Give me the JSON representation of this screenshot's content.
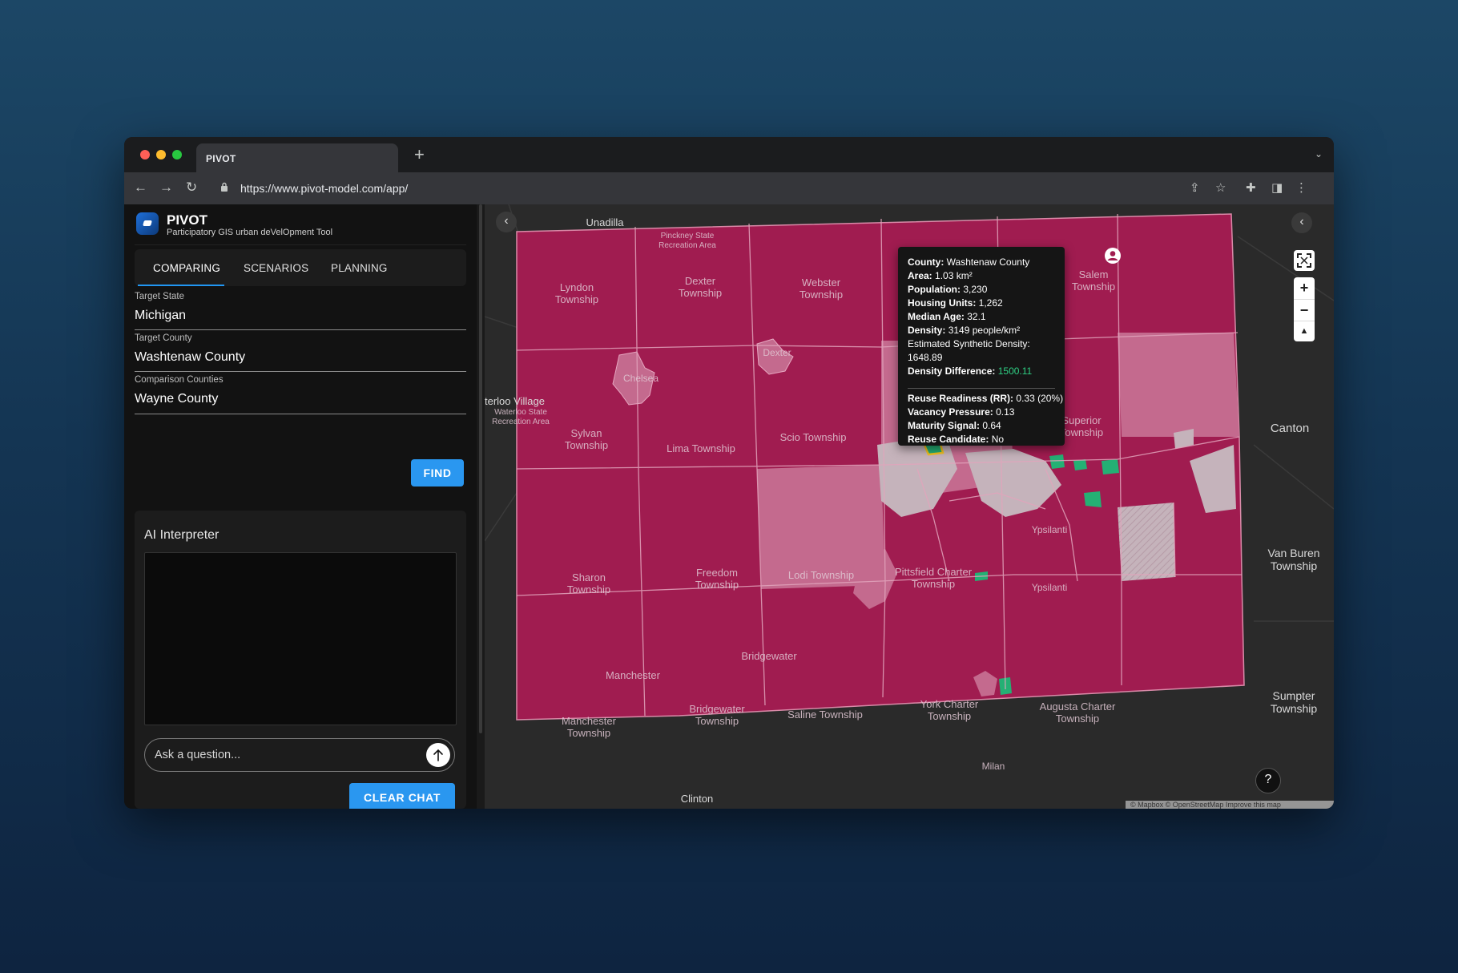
{
  "browser": {
    "tab_title": "PIVOT",
    "new_tab": "+",
    "url": "https://www.pivot-model.com/app/"
  },
  "app": {
    "title": "PIVOT",
    "subtitle": "Participatory GIS urban deVelOpment Tool"
  },
  "tabs": [
    {
      "label": "COMPARING",
      "active": true
    },
    {
      "label": "SCENARIOS",
      "active": false
    },
    {
      "label": "PLANNING",
      "active": false
    }
  ],
  "form": {
    "target_state": {
      "label": "Target State",
      "value": "Michigan"
    },
    "target_county": {
      "label": "Target County",
      "value": "Washtenaw County"
    },
    "comparison_counties": {
      "label": "Comparison Counties",
      "value": "Wayne County"
    },
    "find_label": "FIND"
  },
  "ai": {
    "title": "AI Interpreter",
    "placeholder": "Ask a question...",
    "clear_label": "CLEAR CHAT"
  },
  "map": {
    "colors": {
      "high": "#a01c50",
      "mid": "#c46a8e",
      "low": "#c5b3bb",
      "positive": "#24b074",
      "highlight": "#f0c020"
    },
    "inside_labels": {
      "lyndon": "Lyndon\nTownship",
      "dexter_tp": "Dexter\nTownship",
      "webster": "Webster\nTownship",
      "salem": "Salem\nTownship",
      "pinckney": "Pinckney State\nRecreation Area",
      "chelsea": "Chelsea",
      "dexter": "Dexter",
      "scio": "Scio Township",
      "sylvan": "Sylvan\nTownship",
      "lima": "Lima Township",
      "superior": "Superior\nTownship",
      "sharon": "Sharon\nTownship",
      "freedom": "Freedom\nTownship",
      "lodi": "Lodi Township",
      "pittsfield": "Pittsfield Charter\nTownship",
      "ypsilanti_city": "Ypsilanti",
      "ypsilanti": "Ypsilanti",
      "manchester": "Manchester",
      "manchester_tp": "Manchester\nTownship",
      "bridgewater": "Bridgewater",
      "bridgewater_tp": "Bridgewater\nTownship",
      "saline": "Saline Township",
      "york": "York Charter\nTownship",
      "augusta": "Augusta Charter\nTownship",
      "milan": "Milan",
      "waterloo_area": "Waterloo State\nRecreation Area"
    },
    "outside_labels": {
      "unadilla": "Unadilla",
      "waterloo": "terloo Village",
      "canton": "Canton",
      "van_buren": "Van Buren\nTownship",
      "sumpter": "Sumpter\nTownship",
      "clinton": "Clinton"
    },
    "tooltip": {
      "county": {
        "label": "County:",
        "value": "Washtenaw County"
      },
      "area": {
        "label": "Area:",
        "value": "1.03 km²"
      },
      "population": {
        "label": "Population:",
        "value": "3,230"
      },
      "housing": {
        "label": "Housing Units:",
        "value": "1,262"
      },
      "median_age": {
        "label": "Median Age:",
        "value": "32.1"
      },
      "density": {
        "label": "Density:",
        "value": "3149 people/km²"
      },
      "synthetic": {
        "label": "Estimated Synthetic Density:",
        "value": "1648.89"
      },
      "difference": {
        "label": "Density Difference:",
        "value": "1500.11"
      },
      "reuse": {
        "label": "Reuse Readiness (RR):",
        "value": "0.33 (20%)"
      },
      "vacancy": {
        "label": "Vacancy Pressure:",
        "value": "0.13"
      },
      "maturity": {
        "label": "Maturity Signal:",
        "value": "0.64"
      },
      "candidate": {
        "label": "Reuse Candidate:",
        "value": "No"
      }
    },
    "controls": {
      "zoom_in": "+",
      "zoom_out": "−",
      "help": "?"
    },
    "attribution": "© Mapbox © OpenStreetMap  Improve this map"
  }
}
